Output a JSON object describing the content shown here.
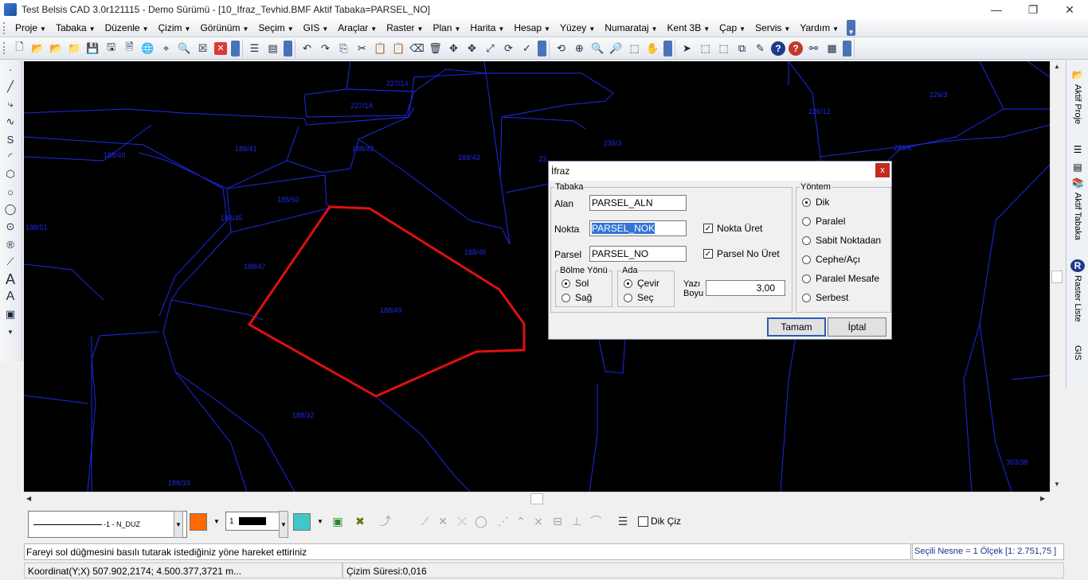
{
  "window": {
    "title": "Test Belsis CAD 3.0r121115 - Demo Sürümü - [10_Ifraz_Tevhid.BMF  Aktif Tabaka=PARSEL_NO]",
    "min": "—",
    "max": "❐",
    "close": "✕"
  },
  "menu": [
    "Proje",
    "Tabaka",
    "Düzenle",
    "Çizim",
    "Görünüm",
    "Seçim",
    "GIS",
    "Araçlar",
    "Raster",
    "Plan",
    "Harita",
    "Hesap",
    "Yüzey",
    "Numarataj",
    "Kent 3B",
    "Çap",
    "Servis",
    "Yardım"
  ],
  "parcels": [
    {
      "label": "227/14"
    },
    {
      "label": "227/1A"
    },
    {
      "label": "188/41"
    },
    {
      "label": "188/42"
    },
    {
      "label": "188/43"
    },
    {
      "label": "235/3"
    },
    {
      "label": "188/40"
    },
    {
      "label": "188/50"
    },
    {
      "label": "188/45"
    },
    {
      "label": "188/51"
    },
    {
      "label": "188/46"
    },
    {
      "label": "188/47"
    },
    {
      "label": "188/49"
    },
    {
      "label": "188/32"
    },
    {
      "label": "188/33"
    },
    {
      "label": "226/3"
    },
    {
      "label": "226/12"
    },
    {
      "label": "226/6"
    },
    {
      "label": "303/38"
    },
    {
      "label": "23"
    }
  ],
  "dialog": {
    "title": "İfraz",
    "close": "x",
    "tabaka_group": "Tabaka",
    "alan_label": "Alan",
    "alan_value": "PARSEL_ALN",
    "nokta_label": "Nokta",
    "nokta_value": "PARSEL_NOK",
    "parsel_label": "Parsel",
    "parsel_value": "PARSEL_NO",
    "nokta_uret": "Nokta Üret",
    "parsel_no_uret": "Parsel No Üret",
    "check_mark": "✓",
    "bolme_group": "Bölme Yönü",
    "sol": "Sol",
    "sag": "Sağ",
    "ada_group": "Ada",
    "cevir": "Çevir",
    "sec": "Seç",
    "yazi_label_1": "Yazı",
    "yazi_label_2": "Boyu",
    "yazi_value": "3,00",
    "yontem_group": "Yöntem",
    "yontem_options": [
      "Dik",
      "Paralel",
      "Sabit Noktadan",
      "Cephe/Açı",
      "Paralel Mesafe",
      "Serbest"
    ],
    "ok": "Tamam",
    "cancel": "İptal"
  },
  "rightdock": {
    "aktif_proje": "Aktif Proje",
    "aktif_tabaka": "Aktif Tabaka",
    "raster_liste": "Raster Liste",
    "gis": "GIS"
  },
  "propbar": {
    "linetype": "-1 - N_DUZ",
    "linewidth": "1",
    "dik_ciz": "Dik Çiz",
    "colors": {
      "line_color": "#ff6a00",
      "fill_color": "#40c8c8"
    }
  },
  "cmdline": "Fareyi sol düğmesini basılı tutarak istediğiniz yöne hareket ettiriniz",
  "selinfo": "Seçili Nesne = 1   Ölçek [1: 2.751,75 ]",
  "status": {
    "coord": "Koordinat(Y;X)  507.902,2174; 4.500.377,3721 m...",
    "time": "Çizim Süresi:0,016"
  },
  "colors": {
    "canvas_bg": "#000000",
    "parcel_line": "#1c2ae6",
    "selected_line": "#e01010"
  }
}
